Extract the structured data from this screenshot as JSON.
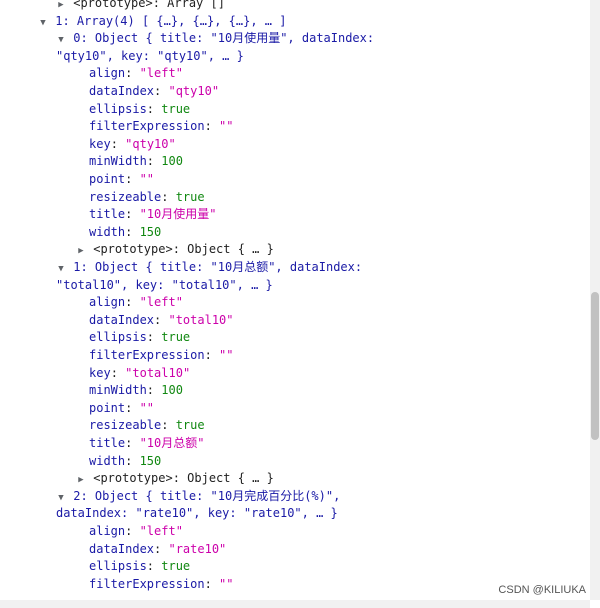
{
  "console": {
    "proto_top": "<prototype>: Array []",
    "array_header_idx": "1:",
    "array_header_type": "Array(4)",
    "array_header_preview": "[ {…}, {…}, {…}, … ]",
    "items": [
      {
        "idx": "0:",
        "summary_a": "Object { title: \"10月使用量\", dataIndex:",
        "summary_b": "\"qty10\", key: \"qty10\", … }",
        "props": [
          {
            "key": "align",
            "value": "\"left\"",
            "kind": "s"
          },
          {
            "key": "dataIndex",
            "value": "\"qty10\"",
            "kind": "s"
          },
          {
            "key": "ellipsis",
            "value": "true",
            "kind": "b"
          },
          {
            "key": "filterExpression",
            "value": "\"\"",
            "kind": "s"
          },
          {
            "key": "key",
            "value": "\"qty10\"",
            "kind": "s"
          },
          {
            "key": "minWidth",
            "value": "100",
            "kind": "n"
          },
          {
            "key": "point",
            "value": "\"\"",
            "kind": "s"
          },
          {
            "key": "resizeable",
            "value": "true",
            "kind": "b"
          },
          {
            "key": "title",
            "value": "\"10月使用量\"",
            "kind": "s"
          },
          {
            "key": "width",
            "value": "150",
            "kind": "n"
          }
        ],
        "proto": "<prototype>: Object { … }"
      },
      {
        "idx": "1:",
        "summary_a": "Object { title: \"10月总额\", dataIndex:",
        "summary_b": "\"total10\", key: \"total10\", … }",
        "props": [
          {
            "key": "align",
            "value": "\"left\"",
            "kind": "s"
          },
          {
            "key": "dataIndex",
            "value": "\"total10\"",
            "kind": "s"
          },
          {
            "key": "ellipsis",
            "value": "true",
            "kind": "b"
          },
          {
            "key": "filterExpression",
            "value": "\"\"",
            "kind": "s"
          },
          {
            "key": "key",
            "value": "\"total10\"",
            "kind": "s"
          },
          {
            "key": "minWidth",
            "value": "100",
            "kind": "n"
          },
          {
            "key": "point",
            "value": "\"\"",
            "kind": "s"
          },
          {
            "key": "resizeable",
            "value": "true",
            "kind": "b"
          },
          {
            "key": "title",
            "value": "\"10月总额\"",
            "kind": "s"
          },
          {
            "key": "width",
            "value": "150",
            "kind": "n"
          }
        ],
        "proto": "<prototype>: Object { … }"
      },
      {
        "idx": "2:",
        "summary_a": "Object { title: \"10月完成百分比(%)\",",
        "summary_b": "dataIndex: \"rate10\", key: \"rate10\", … }",
        "props": [
          {
            "key": "align",
            "value": "\"left\"",
            "kind": "s"
          },
          {
            "key": "dataIndex",
            "value": "\"rate10\"",
            "kind": "s"
          },
          {
            "key": "ellipsis",
            "value": "true",
            "kind": "b"
          },
          {
            "key": "filterExpression",
            "value": "\"\"",
            "kind": "s"
          }
        ]
      }
    ]
  },
  "watermark": "CSDN @KILIUKA",
  "colors": {
    "key": "#1a1aa6",
    "string": "#cc00aa",
    "bool": "#118811",
    "number": "#118811"
  }
}
